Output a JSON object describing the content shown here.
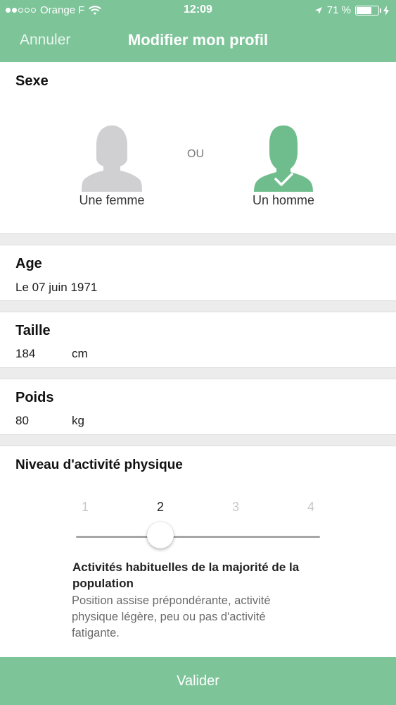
{
  "status_bar": {
    "carrier": "Orange F",
    "time": "12:09",
    "battery_text": "71 %",
    "battery_level": 0.71,
    "signal_bars_filled": 2,
    "signal_bars_total": 5
  },
  "nav": {
    "cancel_label": "Annuler",
    "title": "Modifier mon profil"
  },
  "sexe": {
    "heading": "Sexe",
    "female_label": "Une femme",
    "separator": "OU",
    "male_label": "Un homme",
    "selected": "male"
  },
  "age": {
    "heading": "Age",
    "value": "Le 07 juin 1971"
  },
  "taille": {
    "heading": "Taille",
    "value": "184",
    "unit": "cm"
  },
  "poids": {
    "heading": "Poids",
    "value": "80",
    "unit": "kg"
  },
  "activity": {
    "heading": "Niveau d'activité physique",
    "levels": [
      "1",
      "2",
      "3",
      "4"
    ],
    "selected_level": 2,
    "description_title": "Activités habituelles de la majorité de la population",
    "description": "Position assise prépondérante, activité physique légère, peu ou pas d'activité fatigante."
  },
  "footer": {
    "validate_label": "Valider"
  },
  "colors": {
    "accent": "#7dc499",
    "unselected_avatar": "#d0d0d3",
    "selected_avatar": "#6fbd8d"
  }
}
